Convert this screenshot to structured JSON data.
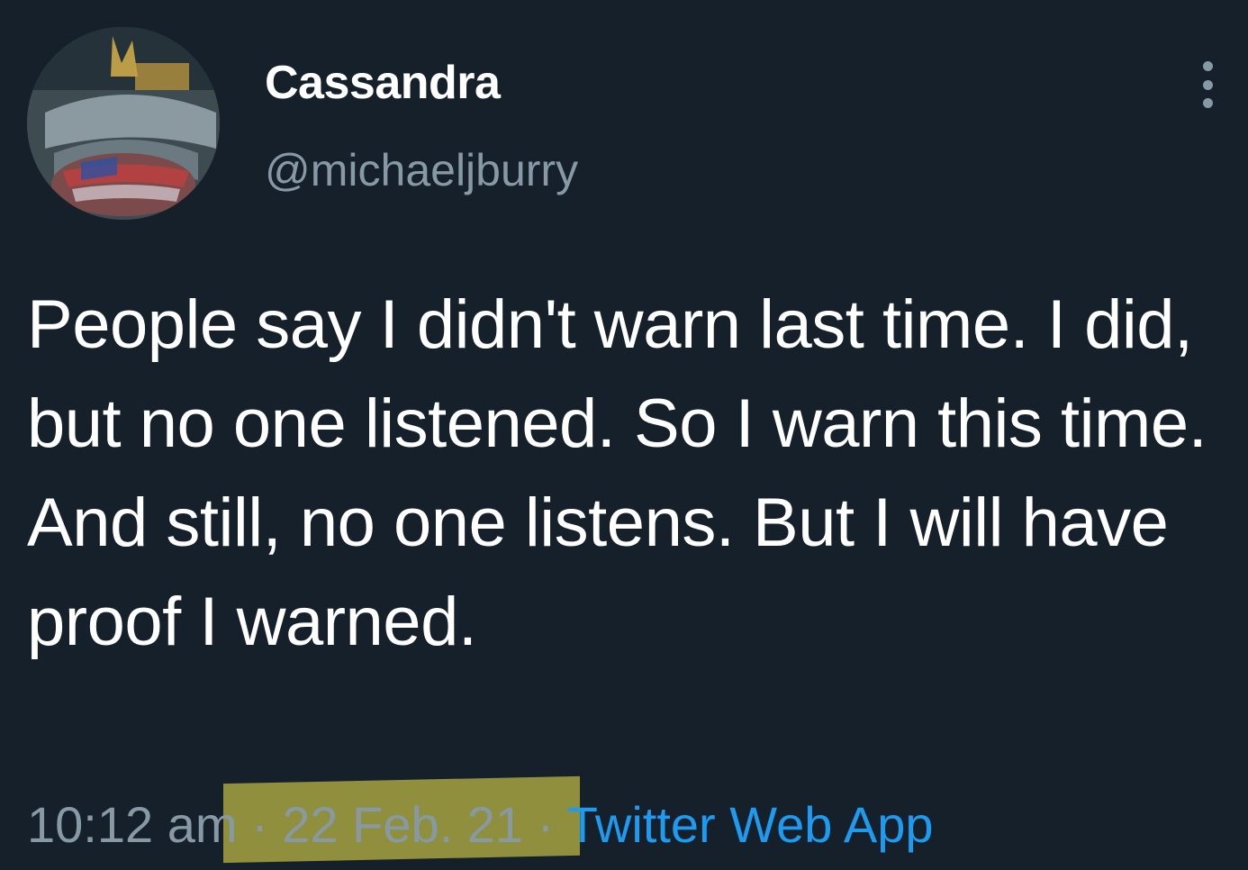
{
  "tweet": {
    "display_name": "Cassandra",
    "handle": "@michaeljburry",
    "text": "People say I didn't warn last time. I did, but no one listened. So I warn this time. And still, no one listens. But I will have proof I warned.",
    "time": "10:12 am",
    "separator1": "·",
    "date": "22 Feb. 21",
    "separator2": "·",
    "source": "Twitter Web App"
  },
  "icons": {
    "more": "more-vertical-icon",
    "avatar": "profile-photo"
  },
  "colors": {
    "background": "#15202b",
    "primary_text": "#ffffff",
    "secondary_text": "#8899a6",
    "link": "#1d9bf0",
    "highlight": "#b9b446"
  }
}
